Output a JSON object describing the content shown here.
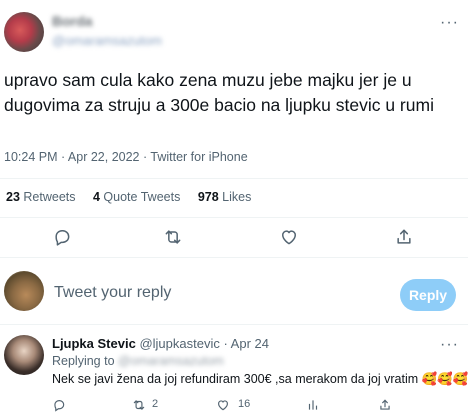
{
  "tweet": {
    "author_name": "Borda",
    "author_handle": "@omaramsazutom",
    "more": "···",
    "text": "upravo sam cula kako zena muzu jebe majku jer je u dugovima za struju a 300e bacio na ljupku stevic u rumi",
    "meta": "10:24 PM · Apr 22, 2022 · Twitter for iPhone",
    "stats": {
      "retweets_count": "23",
      "retweets_label": "Retweets",
      "quotes_count": "4",
      "quotes_label": "Quote Tweets",
      "likes_count": "978",
      "likes_label": "Likes"
    },
    "actions": [
      "reply-icon",
      "retweet-icon",
      "like-icon",
      "share-icon"
    ]
  },
  "composer": {
    "placeholder": "Tweet your reply",
    "button_label": "Reply"
  },
  "reply": {
    "name": "Ljupka Stevic",
    "handle_time": "@ljupkastevic · Apr 24",
    "replying_label": "Replying to",
    "replying_handle": "@omaramsazutom",
    "more": "···",
    "text": "Nek se javi žena da joj refundiram 300€ ,sa merakom da joj vratim",
    "emojis": "🥰🥰🥰",
    "retweet_count": "2",
    "like_count": "16"
  },
  "colors": {
    "accent": "#1d9bf0",
    "reply_button": "#8ecdf8",
    "muted_text": "#536471",
    "divider": "#eff3f4"
  }
}
